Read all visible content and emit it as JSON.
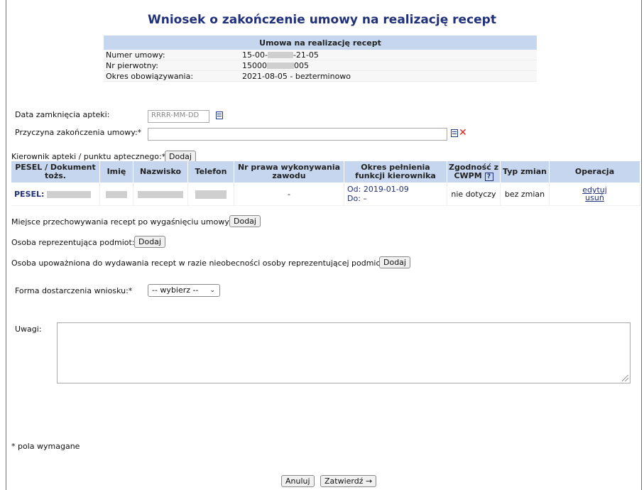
{
  "page": {
    "title": "Wniosek o zakończenie umowy na realizację recept"
  },
  "contract": {
    "header": "Umowa na realizację recept",
    "rows": [
      {
        "label": "Numer umowy:",
        "value_prefix": "15-00-",
        "value_suffix": "-21-05"
      },
      {
        "label": "Nr pierwotny:",
        "value_prefix": "15000",
        "value_suffix": "005"
      },
      {
        "label": "Okres obowiązywania:",
        "value_prefix": "2021-08-05 - bezterminowo",
        "value_suffix": ""
      }
    ]
  },
  "form": {
    "closing_date_label": "Data zamknięcia apteki:",
    "closing_date_placeholder": "RRRR-MM-DD",
    "reason_label": "Przyczyna zakończenia umowy:*",
    "reason_value": "",
    "manager_label": "Kierownik apteki / punktu aptecznego:*",
    "add_label": "Dodaj",
    "storage_label": "Miejsce przechowywania recept po wygaśnięciu umowy:*",
    "representative_label": "Osoba reprezentująca podmiot:",
    "authorized_label": "Osoba upoważniona do wydawania recept w razie nieobecności osoby reprezentującej podmiot:*",
    "delivery_label": "Forma dostarczenia wniosku:*",
    "delivery_selected": "-- wybierz --",
    "notes_label": "Uwagi:",
    "required_note": "* pola wymagane",
    "cancel_label": "Anuluj",
    "submit_label": "Zatwierdź →"
  },
  "manager_table": {
    "headers": [
      "PESEL / Dokument tożs.",
      "Imię",
      "Nazwisko",
      "Telefon",
      "Nr prawa wykonywania zawodu",
      "Okres pełnienia funkcji kierownika",
      "Zgodność z CWPM",
      "Typ zmian",
      "Operacja"
    ],
    "help_glyph": "?",
    "row": {
      "pesel_label": "PESEL:",
      "license": "-",
      "period_from": "Od: 2019-01-09",
      "period_to": "Do: –",
      "compliance": "nie dotyczy",
      "change_type": "bez zmian",
      "edit": "edytuj",
      "delete": "usuń"
    }
  }
}
